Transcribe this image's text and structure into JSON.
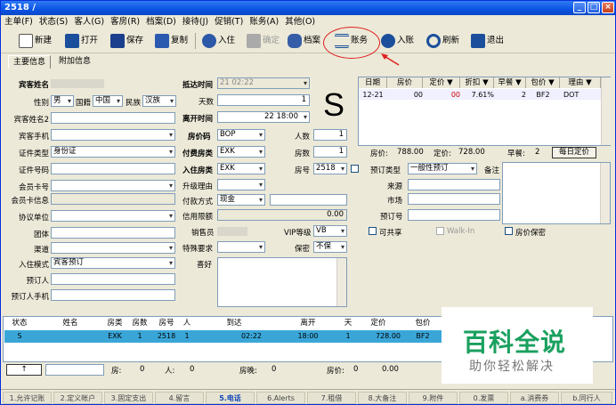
{
  "window": {
    "title": "2518  /"
  },
  "menu": [
    "主单(F)",
    "状态(S)",
    "客人(G)",
    "客房(R)",
    "档案(D)",
    "接待(J)",
    "促销(T)",
    "账务(A)",
    "其他(O)"
  ],
  "toolbar": {
    "new": "新建",
    "open": "打开",
    "save": "保存",
    "copy": "复制",
    "checkin": "入住",
    "ok": "确定",
    "profile": "档案",
    "account": "账务",
    "post": "入账",
    "refresh": "刷新",
    "exit": "退出"
  },
  "tabs": {
    "main": "主要信息",
    "extra": "附加信息"
  },
  "guest": {
    "name_label": "宾客姓名",
    "gender_label": "性别",
    "gender": "男",
    "country_label": "国籍",
    "country": "中国",
    "ethnic_label": "民族",
    "ethnic": "汉族",
    "name2_label": "宾客姓名2",
    "phone_label": "宾客手机",
    "idtype_label": "证件类型",
    "idtype": "身份证",
    "idno_label": "证件号码",
    "member_label": "会员卡号",
    "memberinfo_label": "会员卡信息",
    "agreement_label": "协议单位",
    "group_label": "团体",
    "channel_label": "渠道",
    "checkin_mode_label": "入住模式",
    "checkin_mode": "宾客预订",
    "booker_label": "预订人",
    "booker_phone_label": "预订人手机"
  },
  "stay": {
    "arrive_label": "抵达时间",
    "arrive": "21 02:22",
    "days_label": "天数",
    "days": "1",
    "depart_label": "离开时间",
    "depart": "22 18:00",
    "rate_code_label": "房价码",
    "rate_code": "BOP",
    "persons_label": "人数",
    "persons": "1",
    "charge_type_label": "付费房类",
    "charge_type": "EXK",
    "rooms_label": "房数",
    "rooms": "1",
    "room_type_label": "入住房类",
    "room_type": "EXK",
    "room_no_label": "房号",
    "room_no": "2518",
    "upgrade_label": "升级理由",
    "pay_label": "付款方式",
    "pay": "现金",
    "credit_label": "信用限额",
    "credit": "0.00",
    "sales_label": "销售员",
    "vip_label": "VIP等级",
    "vip": "VB",
    "special_label": "特殊要求",
    "secret_label": "保密",
    "secret": "不保",
    "hobby_label": "喜好",
    "status_flag": "S"
  },
  "booking": {
    "type_label": "预订类型",
    "type": "一般性预订",
    "source_label": "来源",
    "market_label": "市场",
    "booking_no_label": "预订号",
    "memo_label": "备注",
    "shareable": "可共享",
    "walkin": "Walk-In",
    "rate_secret": "房价保密"
  },
  "rate_grid": {
    "headers": [
      "日期",
      "房价",
      "定价 ▼",
      "折扣 ▼",
      "早餐 ▼",
      "包价 ▼",
      "理由 ▼"
    ],
    "rows": [
      [
        "12-21",
        "00",
        "00",
        "7.61%",
        "2",
        "BF2",
        "DOT"
      ]
    ]
  },
  "rate_summary": {
    "price_label": "房价:",
    "price": "788.00",
    "list_label": "定价:",
    "list": "728.00",
    "bf_label": "早餐:",
    "bf": "2",
    "daily_btn": "每日定价"
  },
  "room_grid": {
    "headers": [
      "状态",
      "姓名",
      "房类",
      "房数",
      "房号",
      "人",
      "到达",
      "离开",
      "天",
      "定价",
      "包价"
    ],
    "rows": [
      [
        "S",
        "",
        "EXK",
        "1",
        "2518",
        "1",
        "02:22",
        "18:00",
        "1",
        "728.00",
        "BF2"
      ]
    ]
  },
  "totals": {
    "rooms_label": "房:",
    "rooms": "0",
    "persons_label": "人:",
    "persons": "0",
    "nights_label": "房晚:",
    "nights": "0",
    "price_label": "房价:",
    "price": "0",
    "amount": "0.00"
  },
  "status_tabs": [
    "1.允许记账",
    "2.定义帐户",
    "3.固定支出",
    "4.留言",
    "5.电话",
    "6.Alerts",
    "7.租借",
    "8.大备注",
    "9.附件",
    "0.发票",
    "a.消费券",
    "b.同行人"
  ],
  "watermark": {
    "title": "百科全说",
    "subtitle": "助你轻松解决"
  }
}
